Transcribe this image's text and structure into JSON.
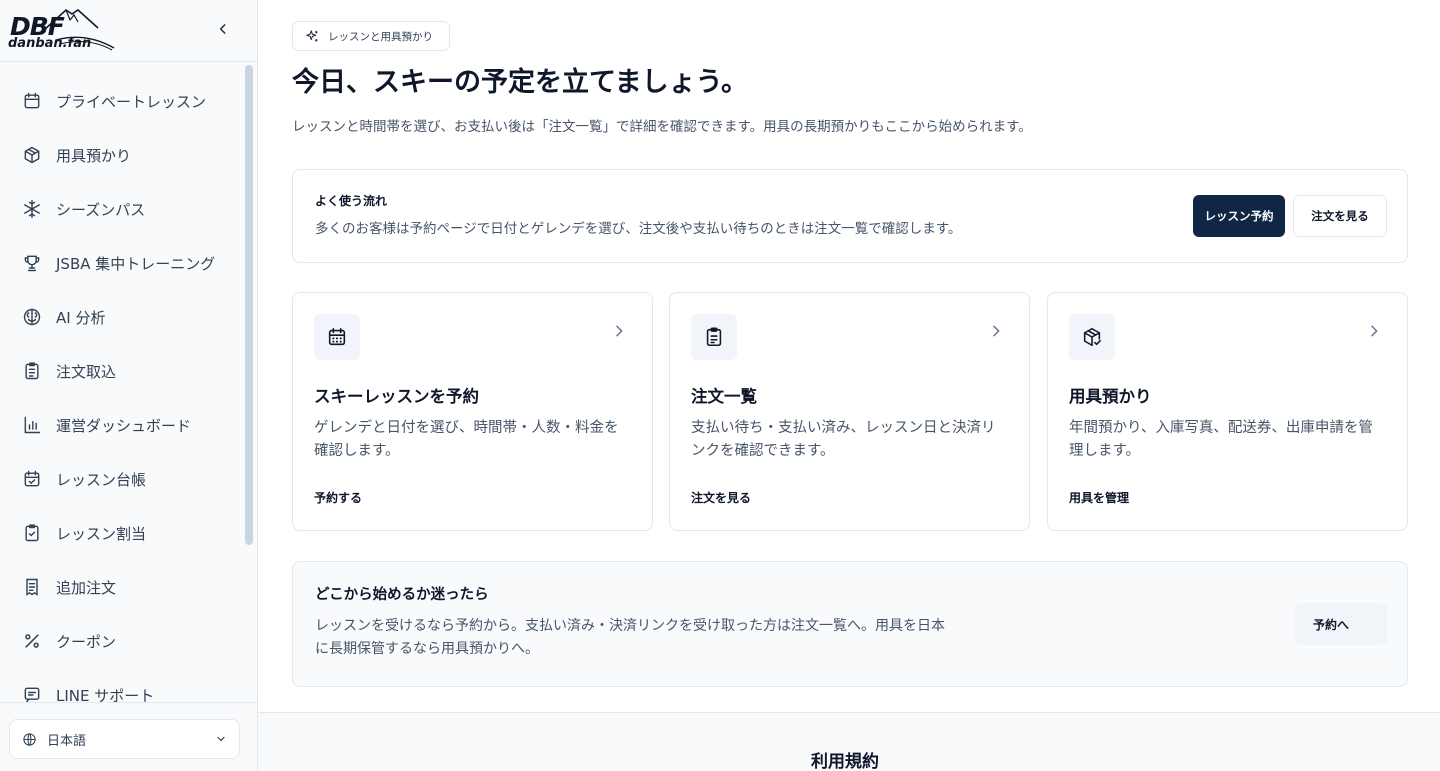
{
  "logo": {
    "brand": "DBF",
    "domain": "danban.fan"
  },
  "sidebar": {
    "items": [
      {
        "label": "プライベートレッスン",
        "icon": "calendar-icon"
      },
      {
        "label": "用具預かり",
        "icon": "package-icon"
      },
      {
        "label": "シーズンパス",
        "icon": "snowflake-icon"
      },
      {
        "label": "JSBA 集中トレーニング",
        "icon": "trophy-icon"
      },
      {
        "label": "AI 分析",
        "icon": "brain-icon"
      },
      {
        "label": "注文取込",
        "icon": "clipboard-list-icon"
      },
      {
        "label": "運営ダッシュボード",
        "icon": "bar-chart-icon"
      },
      {
        "label": "レッスン台帳",
        "icon": "calendar-check-icon"
      },
      {
        "label": "レッスン割当",
        "icon": "clipboard-check-icon"
      },
      {
        "label": "追加注文",
        "icon": "receipt-icon"
      },
      {
        "label": "クーポン",
        "icon": "percent-icon"
      },
      {
        "label": "LINE サポート",
        "icon": "message-icon"
      }
    ],
    "language": "日本語"
  },
  "main": {
    "badge": "レッスンと用具預かり",
    "title": "今日、スキーの予定を立てましょう。",
    "subtitle": "レッスンと時間帯を選び、お支払い後は「注文一覧」で詳細を確認できます。用具の長期預かりもここから始められます。",
    "flow": {
      "title": "よく使う流れ",
      "description": "多くのお客様は予約ページで日付とゲレンデを選び、注文後や支払い待ちのときは注文一覧で確認します。",
      "primary_button": "レッスン予約",
      "secondary_button": "注文を見る"
    },
    "cards": [
      {
        "title": "スキーレッスンを予約",
        "description": "ゲレンデと日付を選び、時間帯・人数・料金を確認します。",
        "action": "予約する"
      },
      {
        "title": "注文一覧",
        "description": "支払い待ち・支払い済み、レッスン日と決済リンクを確認できます。",
        "action": "注文を見る"
      },
      {
        "title": "用具預かり",
        "description": "年間預かり、入庫写真、配送券、出庫申請を管理します。",
        "action": "用具を管理"
      }
    ],
    "help": {
      "title": "どこから始めるか迷ったら",
      "description": "レッスンを受けるなら予約から。支払い済み・決済リンクを受け取った方は注文一覧へ。用具を日本に長期保管するなら用具預かりへ。",
      "button": "予約へ"
    }
  },
  "footer": {
    "title": "利用規約"
  },
  "colors": {
    "primary": "#0f2744",
    "text": "#0f172a",
    "muted": "#475569",
    "border": "#e2e8f0",
    "surface": "#f8fafc"
  }
}
